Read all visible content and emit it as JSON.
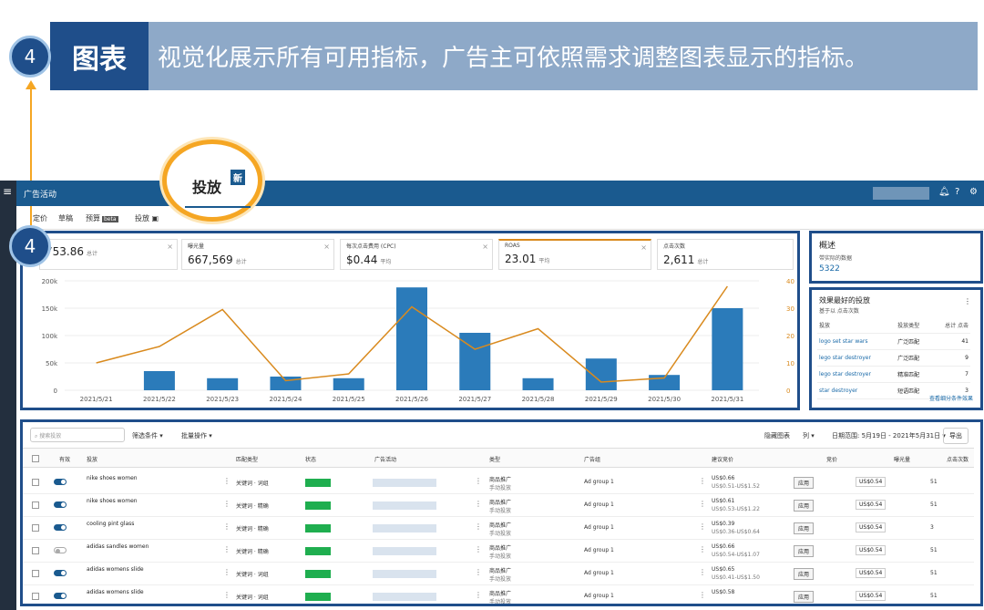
{
  "banner": {
    "tag": "图表",
    "text": "视觉化展示所有可用指标，广告主可依照需求调整图表显示的指标。"
  },
  "step_numbers": [
    "4",
    "4"
  ],
  "topbar": {
    "title": "广告活动"
  },
  "tabs": [
    "定价",
    "草稿",
    "预算",
    "投放"
  ],
  "beta_tag": "beta",
  "callout": {
    "label": "投放",
    "badge": "新"
  },
  "metrics": [
    {
      "label": "",
      "value": "753.86",
      "sub": "总计"
    },
    {
      "label": "曝光量",
      "value": "667,569",
      "sub": "总计"
    },
    {
      "label": "每次点击费用 (CPC)",
      "value": "$0.44",
      "sub": "平均"
    },
    {
      "label": "ROAS",
      "value": "23.01",
      "sub": "平均"
    },
    {
      "label": "点击次数",
      "value": "2,611",
      "sub": "总计"
    }
  ],
  "chart_data": {
    "type": "bar",
    "categories": [
      "2021/5/21",
      "2021/5/22",
      "2021/5/23",
      "2021/5/24",
      "2021/5/25",
      "2021/5/26",
      "2021/5/27",
      "2021/5/28",
      "2021/5/29",
      "2021/5/30",
      "2021/5/31"
    ],
    "series": [
      {
        "type": "bar",
        "axis": "left",
        "color": "#2b7bba",
        "values": [
          0,
          35000,
          22000,
          25000,
          22000,
          188000,
          105000,
          22000,
          58000,
          28000,
          150000
        ]
      },
      {
        "type": "line",
        "axis": "right",
        "color": "#d98a1e",
        "values": [
          10,
          16,
          29.5,
          3.5,
          6,
          30.5,
          15,
          22.5,
          3,
          4.5,
          38
        ]
      }
    ],
    "left_ticks": [
      "0",
      "50k",
      "100k",
      "150k",
      "200k"
    ],
    "right_ticks": [
      "0",
      "10",
      "20",
      "30",
      "40"
    ],
    "ylim_left": [
      0,
      200000
    ],
    "ylim_right": [
      0,
      40
    ]
  },
  "overview": {
    "title": "概述",
    "subtitle": "带实际的数据",
    "value": "5322"
  },
  "top_targets": {
    "title": "效果最好的投放",
    "subtitle": "基于以 点击次数",
    "headers": [
      "投放",
      "投放类型",
      "总计 点击"
    ],
    "rows": [
      {
        "name": "logo set star wars",
        "type": "广泛匹配",
        "value": "41"
      },
      {
        "name": "lego star destroyer",
        "type": "广泛匹配",
        "value": "9"
      },
      {
        "name": "lego star destroyer",
        "type": "精准匹配",
        "value": "7"
      },
      {
        "name": "star destroyer",
        "type": "短语匹配",
        "value": "3"
      }
    ],
    "more_link": "查看细分条件效果"
  },
  "table": {
    "search_placeholder": "搜索投放",
    "filter_label": "筛选条件 ▾",
    "bulk_label": "批量操作 ▾",
    "hide_chart": "隐藏图表",
    "columns_label": "列 ▾",
    "date_range": "日期范围: 5月19日 - 2021年5月31日 ▾",
    "export": "导出",
    "headers": [
      "有效",
      "投放",
      "匹配类型",
      "状态",
      "广告活动",
      "类型",
      "广告组",
      "建议竞价",
      "竞价",
      "曝光量",
      "点击次数"
    ],
    "rows": [
      {
        "on": true,
        "target": "nike shoes women",
        "match": "关键词 · 词组",
        "type1": "商品推广",
        "type2": "手动投放",
        "group": "Ad group 1",
        "bid1": "US$0.66",
        "bid2": "US$0.51-US$1.52",
        "bid": "US$0.54",
        "imp": "51"
      },
      {
        "on": true,
        "target": "nike shoes women",
        "match": "关键词 · 精确",
        "type1": "商品推广",
        "type2": "手动投放",
        "group": "Ad group 1",
        "bid1": "US$0.61",
        "bid2": "US$0.53-US$1.22",
        "bid": "US$0.54",
        "imp": "51"
      },
      {
        "on": true,
        "target": "cooling pint glass",
        "match": "关键词 · 精确",
        "type1": "商品推广",
        "type2": "手动投放",
        "group": "Ad group 1",
        "bid1": "US$0.39",
        "bid2": "US$0.36-US$0.64",
        "bid": "US$0.54",
        "imp": "3"
      },
      {
        "on": false,
        "target": "adidas sandles women",
        "match": "关键词 · 精确",
        "type1": "商品推广",
        "type2": "手动投放",
        "group": "Ad group 1",
        "bid1": "US$0.66",
        "bid2": "US$0.54-US$1.07",
        "bid": "US$0.54",
        "imp": "51"
      },
      {
        "on": true,
        "target": "adidas womens slide",
        "match": "关键词 · 词组",
        "type1": "商品推广",
        "type2": "手动投放",
        "group": "Ad group 1",
        "bid1": "US$0.65",
        "bid2": "US$0.41-US$1.50",
        "bid": "US$0.54",
        "imp": "51"
      },
      {
        "on": true,
        "target": "adidas womens slide",
        "match": "关键词 · 词组",
        "type1": "商品推广",
        "type2": "手动投放",
        "group": "Ad group 1",
        "bid1": "US$0.58",
        "bid2": "",
        "bid": "US$0.54",
        "imp": "51"
      }
    ],
    "apply_label": "应用"
  }
}
